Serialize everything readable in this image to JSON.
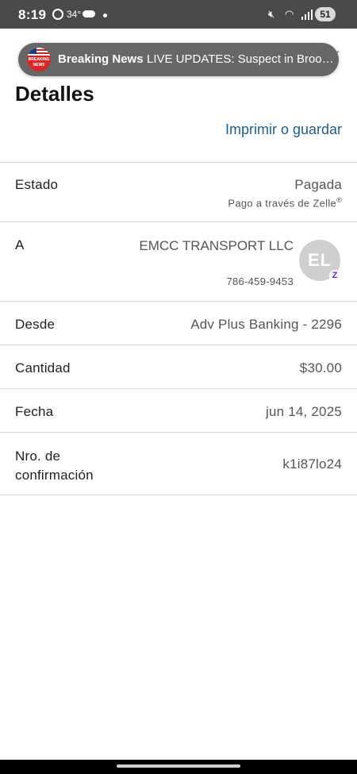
{
  "status_bar": {
    "time": "8:19",
    "temperature": "34°",
    "battery": "51",
    "icons": [
      "app-notification-icon",
      "cloud-icon",
      "dot-icon",
      "mute-icon",
      "wifi-icon",
      "signal-icon",
      "battery-icon"
    ]
  },
  "notification": {
    "title": "Breaking News",
    "text": "LIVE UPDATES: Suspect in Brooklyn Park, Champlin lawmaker shootings",
    "logo_text": "BREAKING NEWS",
    "peek_text": "r"
  },
  "page": {
    "title": "Detalles",
    "print_label": "Imprimir o guardar"
  },
  "details": {
    "estado": {
      "label": "Estado",
      "value": "Pagada",
      "sub": "Pago a través de Zelle",
      "sup": "®"
    },
    "recipient": {
      "label": "A",
      "name": "EMCC TRANSPORT LLC",
      "phone": "786-459-9453",
      "initials": "EL",
      "badge": "Z"
    },
    "desde": {
      "label": "Desde",
      "value": "Adv Plus Banking - 2296"
    },
    "cantidad": {
      "label": "Cantidad",
      "value": "$30.00"
    },
    "fecha": {
      "label": "Fecha",
      "value": "jun 14, 2025"
    },
    "confirmacion": {
      "label": "Nro. de confirmación",
      "value": "k1i87lo24"
    }
  },
  "colors": {
    "link": "#1b5e94",
    "status_bar": "#4a4a4a",
    "banner": "#676767",
    "zelle": "#6d1ed4"
  }
}
